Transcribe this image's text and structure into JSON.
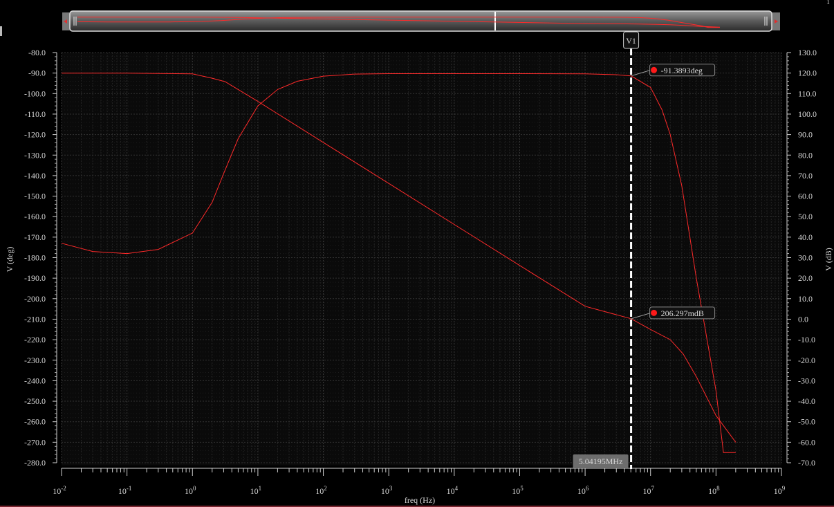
{
  "corner_label": "1",
  "chart_data": {
    "type": "line",
    "x_scale": "log",
    "xlim": [
      0.01,
      1000000000
    ],
    "x_tick_labels": [
      "10-2",
      "10-1",
      "100",
      "101",
      "102",
      "103",
      "104",
      "105",
      "106",
      "107",
      "108",
      "109"
    ],
    "x_tick_bases": [
      "10",
      "10",
      "10",
      "10",
      "10",
      "10",
      "10",
      "10",
      "10",
      "10",
      "10",
      "10"
    ],
    "x_tick_exps": [
      "-2",
      "-1",
      "0",
      "1",
      "2",
      "3",
      "4",
      "5",
      "6",
      "7",
      "8",
      "9"
    ],
    "xlabel": "freq (Hz)",
    "left_axis": {
      "label": "V (deg)",
      "ylim": [
        -280,
        -80
      ],
      "ticks": [
        "-80.0",
        "-90.0",
        "-100.0",
        "-110.0",
        "-120.0",
        "-130.0",
        "-140.0",
        "-150.0",
        "-160.0",
        "-170.0",
        "-180.0",
        "-190.0",
        "-200.0",
        "-210.0",
        "-220.0",
        "-230.0",
        "-240.0",
        "-250.0",
        "-260.0",
        "-270.0",
        "-280.0"
      ]
    },
    "right_axis": {
      "label": "V (dB)",
      "ylim": [
        -70,
        130
      ],
      "ticks": [
        "130.0",
        "120.0",
        "110.0",
        "100.0",
        "90.0",
        "80.0",
        "70.0",
        "60.0",
        "50.0",
        "40.0",
        "30.0",
        "20.0",
        "10.0",
        "0.0",
        "-10.0",
        "-20.0",
        "-30.0",
        "-40.0",
        "-50.0",
        "-60.0",
        "-70.0"
      ]
    },
    "grid": true,
    "color": "#ff2a2a",
    "series": [
      {
        "axis": "right",
        "x": [
          0.01,
          0.1,
          1,
          2,
          3.16,
          5,
          10,
          100,
          1000,
          10000,
          100000,
          1000000,
          5041950,
          10000000,
          20000000,
          31600000,
          50000000,
          100000000,
          200000000
        ],
        "y": [
          120,
          120,
          119.6,
          117.5,
          115.8,
          112,
          106.2,
          86.2,
          66.2,
          46.2,
          26.2,
          6.3,
          0.206,
          -5,
          -10,
          -17,
          -28,
          -47,
          -60
        ]
      },
      {
        "axis": "left",
        "x": [
          0.01,
          0.03,
          0.1,
          0.3,
          1,
          2,
          3,
          5,
          10,
          20,
          40,
          100,
          300,
          1000,
          10000,
          100000,
          1000000,
          3000000,
          5041950,
          10000000,
          15000000,
          20000000,
          30000000,
          50000000,
          100000000,
          130000000,
          200000000
        ],
        "y": [
          -173,
          -177,
          -178,
          -176,
          -168,
          -153,
          -139,
          -122,
          -106,
          -98,
          -94,
          -91.5,
          -90.5,
          -90.3,
          -90.3,
          -90.3,
          -90.4,
          -90.8,
          -91.3893,
          -97,
          -108,
          -120,
          -145,
          -190,
          -245,
          -275,
          -275
        ]
      }
    ],
    "cursor": {
      "name": "V1",
      "freq_label": "5.04195MHz",
      "x": 5041950
    },
    "markers": [
      {
        "label": "-91.3893deg",
        "axis": "left",
        "y": -91.3893
      },
      {
        "label": "206.297mdB",
        "axis": "right",
        "y": 0.206297
      }
    ]
  }
}
